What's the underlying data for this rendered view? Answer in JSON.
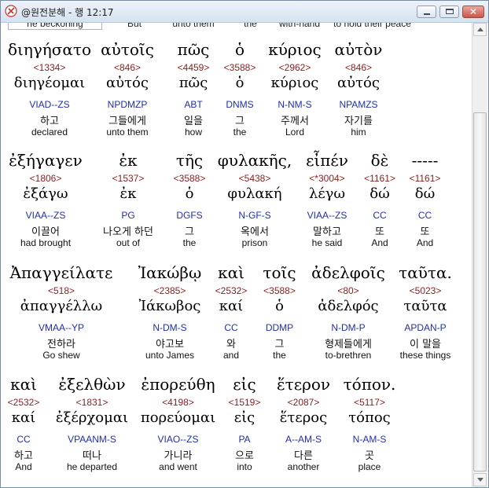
{
  "window": {
    "title": "@원전분해 - 행 12:17"
  },
  "previous_row": [
    "he beckoning",
    "But",
    "unto them",
    "the",
    "with-hand",
    "to hold their peace"
  ],
  "verses": [
    {
      "words": [
        {
          "greek": "διηγήσατο",
          "strong": "<1334>",
          "lemma": "διηγέομαι",
          "morph": "VIAD--ZS",
          "korean": "하고",
          "english": "declared"
        },
        {
          "greek": "αὐτοῖς",
          "strong": "<846>",
          "lemma": "αὐτός",
          "morph": "NPDMZP",
          "korean": "그들에게",
          "english": "unto them"
        },
        {
          "greek": "πῶς",
          "strong": "<4459>",
          "lemma": "πῶς",
          "morph": "ABT",
          "korean": "일을",
          "english": "how"
        },
        {
          "greek": "ὁ",
          "strong": "<3588>",
          "lemma": "ὁ",
          "morph": "DNMS",
          "korean": "그",
          "english": "the"
        },
        {
          "greek": "κύριος",
          "strong": "<2962>",
          "lemma": "κύριος",
          "morph": "N-NM-S",
          "korean": "주께서",
          "english": "Lord"
        },
        {
          "greek": "αὐτὸν",
          "strong": "<846>",
          "lemma": "αὐτός",
          "morph": "NPAMZS",
          "korean": "자기를",
          "english": "him"
        }
      ]
    },
    {
      "words": [
        {
          "greek": "ἐξήγαγεν",
          "strong": "<1806>",
          "lemma": "ἐξάγω",
          "morph": "VIAA--ZS",
          "korean": "이끌어",
          "english": "had brought"
        },
        {
          "greek": "ἐκ",
          "strong": "<1537>",
          "lemma": "ἐκ",
          "morph": "PG",
          "korean": "나오게 하던",
          "english": "out of"
        },
        {
          "greek": "τῆς",
          "strong": "<3588>",
          "lemma": "ὁ",
          "morph": "DGFS",
          "korean": "그",
          "english": "the"
        },
        {
          "greek": "φυλακῆς,",
          "strong": "<5438>",
          "lemma": "φυλακή",
          "morph": "N-GF-S",
          "korean": "옥에서",
          "english": "prison"
        },
        {
          "greek": "εἶπέν",
          "strong": "<*3004>",
          "lemma": "λέγω",
          "morph": "VIAA--ZS",
          "korean": "말하고",
          "english": "he said"
        },
        {
          "greek": "δὲ",
          "strong": "<1161>",
          "lemma": "δώ",
          "morph": "CC",
          "korean": "또",
          "english": "And"
        },
        {
          "greek": "-----",
          "strong": "<1161>",
          "lemma": "δώ",
          "morph": "CC",
          "korean": "또",
          "english": "And"
        }
      ]
    },
    {
      "words": [
        {
          "greek": "Ἀπαγγείλατε",
          "strong": "<518>",
          "lemma": "ἀπαγγέλλω",
          "morph": "VMAA--YP",
          "korean": "전하라",
          "english": "Go shew"
        },
        {
          "greek": "Ἰακώβῳ",
          "strong": "<2385>",
          "lemma": "Ἰάκωβος",
          "morph": "N-DM-S",
          "korean": "야고보",
          "english": "unto James"
        },
        {
          "greek": "καὶ",
          "strong": "<2532>",
          "lemma": "καί",
          "morph": "CC",
          "korean": "와",
          "english": "and"
        },
        {
          "greek": "τοῖς",
          "strong": "<3588>",
          "lemma": "ὁ",
          "morph": "DDMP",
          "korean": "그",
          "english": "the"
        },
        {
          "greek": "ἀδελφοῖς",
          "strong": "<80>",
          "lemma": "ἀδελφός",
          "morph": "N-DM-P",
          "korean": "형제들에게",
          "english": "to-brethren"
        },
        {
          "greek": "ταῦτα.",
          "strong": "<5023>",
          "lemma": "ταῦτα",
          "morph": "APDAN-P",
          "korean": "이 말을",
          "english": "these things"
        }
      ]
    },
    {
      "words": [
        {
          "greek": "καὶ",
          "strong": "<2532>",
          "lemma": "καί",
          "morph": "CC",
          "korean": "하고",
          "english": "And"
        },
        {
          "greek": "ἐξελθὼν",
          "strong": "<1831>",
          "lemma": "ἐξέρχομαι",
          "morph": "VPAANM-S",
          "korean": "떠나",
          "english": "he departed"
        },
        {
          "greek": "ἐπορεύθη",
          "strong": "<4198>",
          "lemma": "πορεύομαι",
          "morph": "VIAO--ZS",
          "korean": "가니라",
          "english": "and went"
        },
        {
          "greek": "εἰς",
          "strong": "<1519>",
          "lemma": "εἰς",
          "morph": "PA",
          "korean": "으로",
          "english": "into"
        },
        {
          "greek": "ἕτερον",
          "strong": "<2087>",
          "lemma": "ἕτερος",
          "morph": "A--AM-S",
          "korean": "다른",
          "english": "another"
        },
        {
          "greek": "τόπον.",
          "strong": "<5117>",
          "lemma": "τόπος",
          "morph": "N-AM-S",
          "korean": "곳",
          "english": "place"
        }
      ]
    }
  ]
}
